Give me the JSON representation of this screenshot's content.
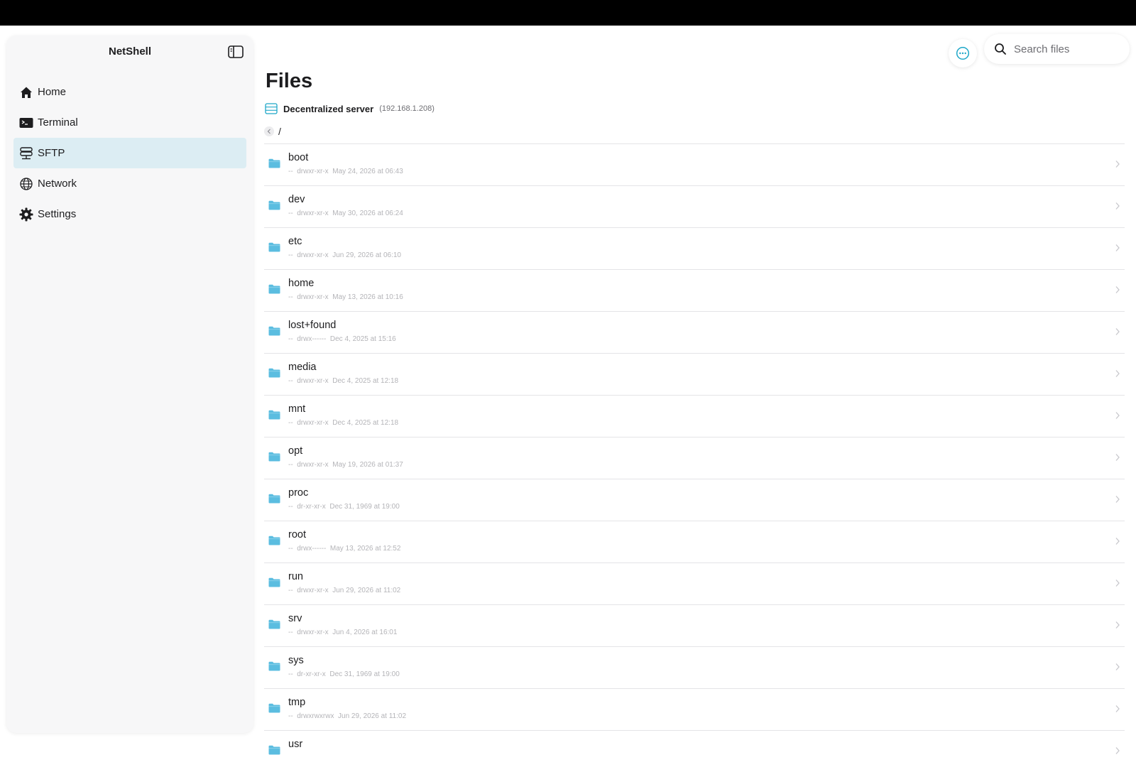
{
  "app": {
    "title": "NetShell"
  },
  "sidebar": {
    "items": [
      {
        "label": "Home",
        "icon": "house-icon"
      },
      {
        "label": "Terminal",
        "icon": "terminal-icon"
      },
      {
        "label": "SFTP",
        "icon": "sftp-icon",
        "active": true
      },
      {
        "label": "Network",
        "icon": "globe-icon"
      },
      {
        "label": "Settings",
        "icon": "gear-icon"
      }
    ]
  },
  "search": {
    "placeholder": "Search files"
  },
  "page": {
    "title": "Files"
  },
  "server": {
    "name": "Decentralized server",
    "ip": "(192.168.1.208)"
  },
  "path": "/",
  "colors": {
    "accent": "#1ea7c8",
    "active_bg": "#dcedf3",
    "folder": "#5bbde0"
  },
  "files": [
    {
      "name": "boot",
      "size": "--",
      "perms": "drwxr-xr-x",
      "date": "May 24, 2026 at 06:43"
    },
    {
      "name": "dev",
      "size": "--",
      "perms": "drwxr-xr-x",
      "date": "May 30, 2026 at 06:24"
    },
    {
      "name": "etc",
      "size": "--",
      "perms": "drwxr-xr-x",
      "date": "Jun 29, 2026 at 06:10"
    },
    {
      "name": "home",
      "size": "--",
      "perms": "drwxr-xr-x",
      "date": "May 13, 2026 at 10:16"
    },
    {
      "name": "lost+found",
      "size": "--",
      "perms": "drwx------",
      "date": "Dec 4, 2025 at 15:16"
    },
    {
      "name": "media",
      "size": "--",
      "perms": "drwxr-xr-x",
      "date": "Dec 4, 2025 at 12:18"
    },
    {
      "name": "mnt",
      "size": "--",
      "perms": "drwxr-xr-x",
      "date": "Dec 4, 2025 at 12:18"
    },
    {
      "name": "opt",
      "size": "--",
      "perms": "drwxr-xr-x",
      "date": "May 19, 2026 at 01:37"
    },
    {
      "name": "proc",
      "size": "--",
      "perms": "dr-xr-xr-x",
      "date": "Dec 31, 1969 at 19:00"
    },
    {
      "name": "root",
      "size": "--",
      "perms": "drwx------",
      "date": "May 13, 2026 at 12:52"
    },
    {
      "name": "run",
      "size": "--",
      "perms": "drwxr-xr-x",
      "date": "Jun 29, 2026 at 11:02"
    },
    {
      "name": "srv",
      "size": "--",
      "perms": "drwxr-xr-x",
      "date": "Jun 4, 2026 at 16:01"
    },
    {
      "name": "sys",
      "size": "--",
      "perms": "dr-xr-xr-x",
      "date": "Dec 31, 1969 at 19:00"
    },
    {
      "name": "tmp",
      "size": "--",
      "perms": "drwxrwxrwx",
      "date": "Jun 29, 2026 at 11:02"
    },
    {
      "name": "usr",
      "size": "",
      "perms": "",
      "date": ""
    }
  ]
}
